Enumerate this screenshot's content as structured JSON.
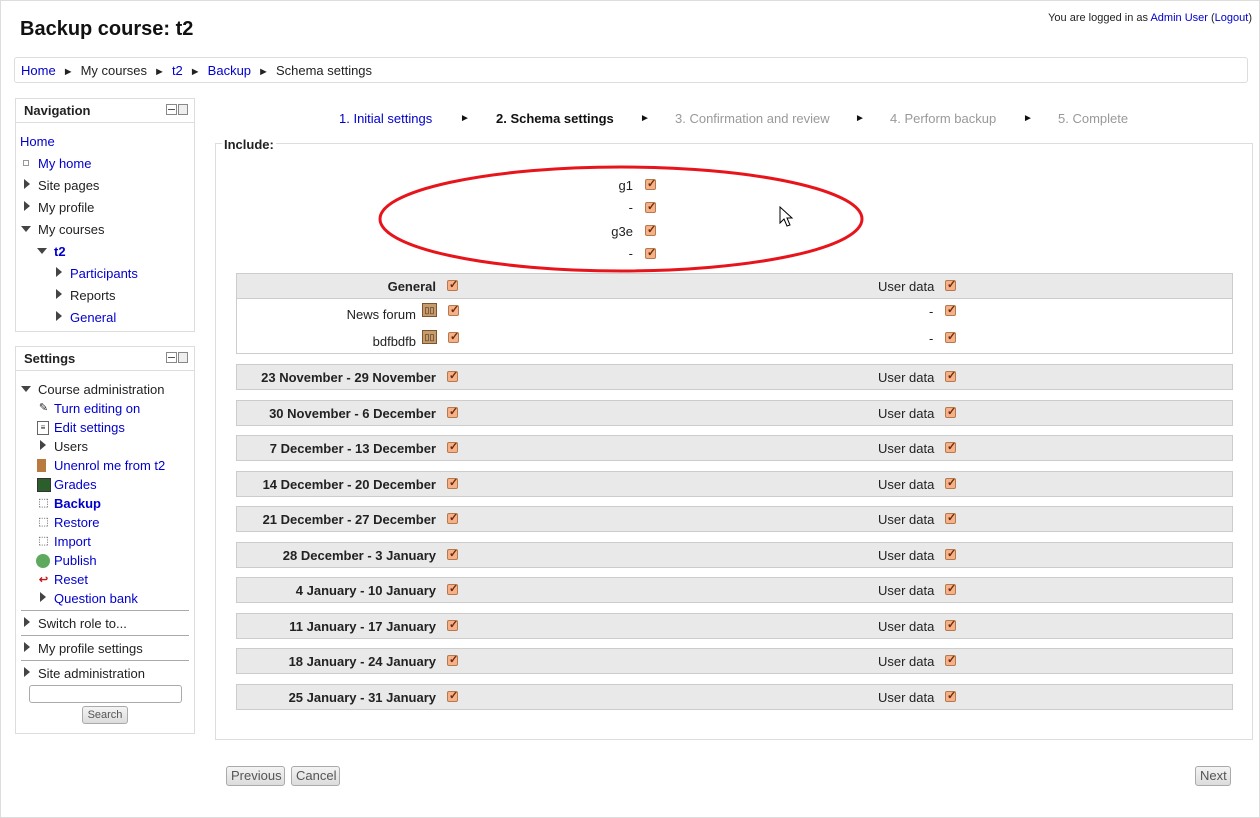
{
  "header": {
    "title": "Backup course: t2",
    "login_prefix": "You are logged in as",
    "login_user": "Admin User",
    "logout": "Logout"
  },
  "breadcrumb": [
    "Home",
    "My courses",
    "t2",
    "Backup",
    "Schema settings"
  ],
  "navigation": {
    "title": "Navigation",
    "home": "Home",
    "my_home": "My home",
    "site_pages": "Site pages",
    "my_profile": "My profile",
    "my_courses": "My courses",
    "course": "t2",
    "participants": "Participants",
    "reports": "Reports",
    "general": "General"
  },
  "settings": {
    "title": "Settings",
    "course_admin": "Course administration",
    "items": [
      "Turn editing on",
      "Edit settings",
      "Users",
      "Unenrol me from t2",
      "Grades",
      "Backup",
      "Restore",
      "Import",
      "Publish",
      "Reset",
      "Question bank"
    ],
    "switch_role": "Switch role to...",
    "profile_settings": "My profile settings",
    "site_admin": "Site administration",
    "search_button": "Search"
  },
  "stepper": [
    "1. Initial settings",
    "2. Schema settings",
    "3. Confirmation and review",
    "4. Perform backup",
    "5. Complete"
  ],
  "include": {
    "legend": "Include:",
    "groupings": [
      "g1",
      "-",
      "g3e",
      "-"
    ]
  },
  "general_section": {
    "title": "General",
    "user_data": "User data",
    "activities": [
      {
        "name": "News forum",
        "dash": "-"
      },
      {
        "name": "bdfbdfb",
        "dash": "-"
      }
    ]
  },
  "weeks": [
    "23 November - 29 November",
    "30 November - 6 December",
    "7 December - 13 December",
    "14 December - 20 December",
    "21 December - 27 December",
    "28 December - 3 January",
    "4 January - 10 January",
    "11 January - 17 January",
    "18 January - 24 January",
    "25 January - 31 January"
  ],
  "user_data_label": "User data",
  "buttons": {
    "previous": "Previous",
    "cancel": "Cancel",
    "next": "Next"
  },
  "colors": {
    "link": "#0000cc",
    "annotation_ellipse": "#e8141b",
    "checkbox": "#f6b08a"
  }
}
